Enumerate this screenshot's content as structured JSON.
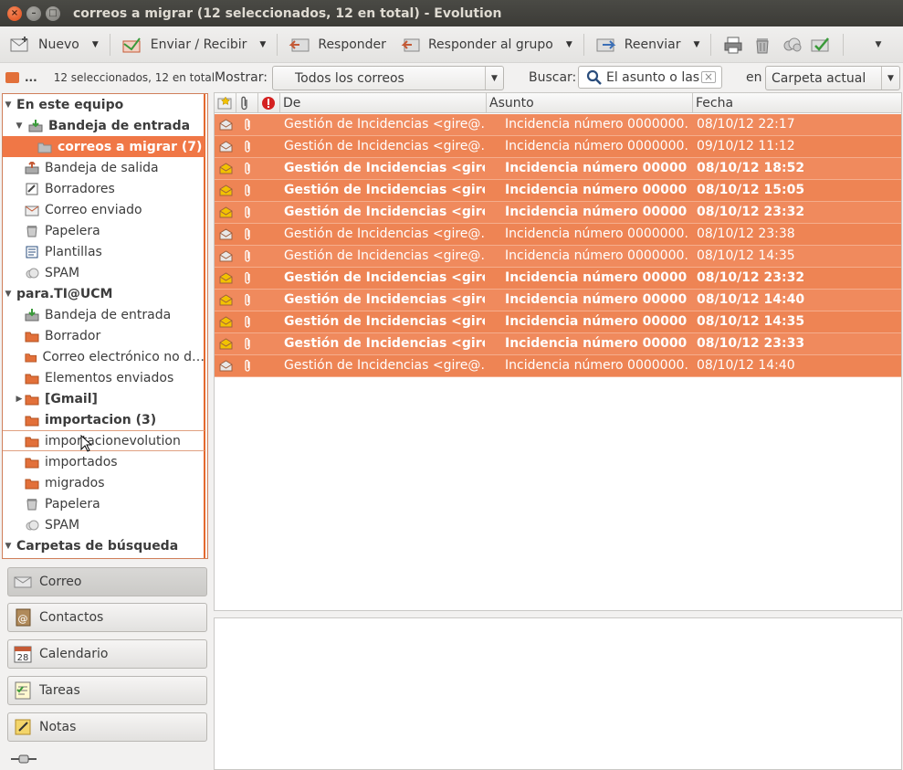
{
  "window": {
    "title": "correos a migrar (12 seleccionados, 12 en total) - Evolution"
  },
  "toolbar": {
    "nuevo": "Nuevo",
    "enviar_recibir": "Enviar / Recibir",
    "responder": "Responder",
    "responder_grupo": "Responder al grupo",
    "reenviar": "Reenviar"
  },
  "filter": {
    "folder_dots": "...",
    "selection_info": "12 seleccionados, 12 en total",
    "mostrar_label": "Mostrar:",
    "mostrar_value": "Todos los correos",
    "buscar_label": "Buscar:",
    "search_placeholder": "El asunto o las",
    "en_label": "en",
    "scope_value": "Carpeta actual"
  },
  "sidebar": {
    "items": [
      {
        "label": "En este equipo"
      },
      {
        "label": "Bandeja de entrada"
      },
      {
        "label": "correos a migrar (7)"
      },
      {
        "label": "Bandeja de salida"
      },
      {
        "label": "Borradores"
      },
      {
        "label": "Correo enviado"
      },
      {
        "label": "Papelera"
      },
      {
        "label": "Plantillas"
      },
      {
        "label": "SPAM"
      },
      {
        "label": "para.TI@UCM"
      },
      {
        "label": "Bandeja de entrada"
      },
      {
        "label": "Borrador"
      },
      {
        "label": "Correo electrónico no d…"
      },
      {
        "label": "Elementos enviados"
      },
      {
        "label": "[Gmail]"
      },
      {
        "label": "importacion (3)"
      },
      {
        "label": "importacionevolution"
      },
      {
        "label": "importados"
      },
      {
        "label": "migrados"
      },
      {
        "label": "Papelera"
      },
      {
        "label": "SPAM"
      },
      {
        "label": "Carpetas de búsqueda"
      }
    ]
  },
  "switcher": {
    "correo": "Correo",
    "contactos": "Contactos",
    "calendario": "Calendario",
    "tareas": "Tareas",
    "notas": "Notas",
    "calendar_day": "28"
  },
  "columns": {
    "de": "De",
    "asunto": "Asunto",
    "fecha": "Fecha"
  },
  "messages": [
    {
      "from": "Gestión de Incidencias <gire@…",
      "subject": "Incidencia número 0000000…",
      "date": "08/10/12 22:17",
      "unread": false
    },
    {
      "from": "Gestión de Incidencias <gire@…",
      "subject": "Incidencia número 0000000…",
      "date": "09/10/12 11:12",
      "unread": false
    },
    {
      "from": "Gestión de Incidencias <gire…",
      "subject": "Incidencia número 000000…",
      "date": "08/10/12 18:52",
      "unread": true
    },
    {
      "from": "Gestión de Incidencias <gire…",
      "subject": "Incidencia número 000000…",
      "date": "08/10/12 15:05",
      "unread": true
    },
    {
      "from": "Gestión de Incidencias <gire…",
      "subject": "Incidencia número 000000…",
      "date": "08/10/12 23:32",
      "unread": true
    },
    {
      "from": "Gestión de Incidencias <gire@…",
      "subject": "Incidencia número 0000000…",
      "date": "08/10/12 23:38",
      "unread": false
    },
    {
      "from": "Gestión de Incidencias <gire@…",
      "subject": "Incidencia número 0000000…",
      "date": "08/10/12 14:35",
      "unread": false
    },
    {
      "from": "Gestión de Incidencias <gire…",
      "subject": "Incidencia número 000000…",
      "date": "08/10/12 23:32",
      "unread": true
    },
    {
      "from": "Gestión de Incidencias <gire…",
      "subject": "Incidencia número 000000…",
      "date": "08/10/12 14:40",
      "unread": true
    },
    {
      "from": "Gestión de Incidencias <gire…",
      "subject": "Incidencia número 000000…",
      "date": "08/10/12 14:35",
      "unread": true
    },
    {
      "from": "Gestión de Incidencias <gire…",
      "subject": "Incidencia número 000000…",
      "date": "08/10/12 23:33",
      "unread": true
    },
    {
      "from": "Gestión de Incidencias <gire@…",
      "subject": "Incidencia número 0000000…",
      "date": "08/10/12 14:40",
      "unread": false
    }
  ],
  "colors": {
    "selection": "#f08a5d",
    "accent": "#e4692f",
    "titlebar": "#3c3b37"
  }
}
